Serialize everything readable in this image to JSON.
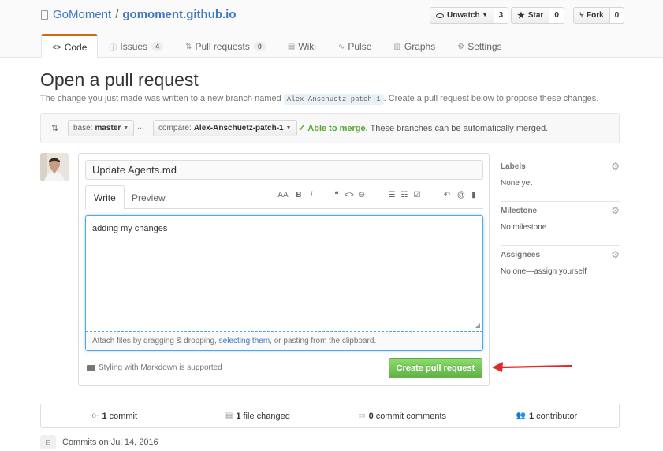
{
  "repo": {
    "owner": "GoMoment",
    "separator": "/",
    "name": "gomoment.github.io"
  },
  "actions": {
    "watch_label": "Unwatch",
    "watch_count": "3",
    "star_label": "Star",
    "star_count": "0",
    "fork_label": "Fork",
    "fork_count": "0"
  },
  "nav": {
    "code": "Code",
    "issues": "Issues",
    "issues_count": "4",
    "pulls": "Pull requests",
    "pulls_count": "0",
    "wiki": "Wiki",
    "pulse": "Pulse",
    "graphs": "Graphs",
    "settings": "Settings"
  },
  "page": {
    "title": "Open a pull request",
    "subtitle_before": "The change you just made was written to a new branch named",
    "branch": "Alex-Anschuetz-patch-1",
    "subtitle_after": ". Create a pull request below to propose these changes."
  },
  "range": {
    "base_label": "base:",
    "base_value": "master",
    "dots": "...",
    "compare_label": "compare:",
    "compare_value": "Alex-Anschuetz-patch-1",
    "merge_ok": "Able to merge.",
    "merge_text": "These branches can be automatically merged."
  },
  "form": {
    "title_value": "Update Agents.md",
    "tab_write": "Write",
    "tab_preview": "Preview",
    "body_text": "adding my changes",
    "drag_before": "Attach files by dragging & dropping,",
    "drag_link": "selecting them",
    "drag_after": ", or pasting from the clipboard.",
    "markdown_note": "Styling with Markdown is supported",
    "submit_label": "Create pull request"
  },
  "toolbar": {
    "heading": "AA",
    "bold": "B",
    "italic": "i",
    "quote": "❝",
    "code": "<>",
    "link": "⊖",
    "ul": "☰",
    "ol": "☷",
    "tasks": "☑",
    "reply": "↶",
    "mention": "@",
    "bookmark": "▮"
  },
  "sidebar": {
    "labels_heading": "Labels",
    "labels_value": "None yet",
    "milestone_heading": "Milestone",
    "milestone_value": "No milestone",
    "assignees_heading": "Assignees",
    "assignees_value": "No one—assign yourself"
  },
  "summary": {
    "commits_count": "1",
    "commits_label": "commit",
    "files_count": "1",
    "files_label": "file changed",
    "comments_count": "0",
    "comments_label": "commit comments",
    "contributors_count": "1",
    "contributors_label": "contributor"
  },
  "commits_on": "Commits on Jul 14, 2016",
  "colors": {
    "link": "#4078c0",
    "accent_tab": "#d26911",
    "success": "#55a532",
    "button_green": "#60b044",
    "annotation_arrow": "#e8262a"
  }
}
